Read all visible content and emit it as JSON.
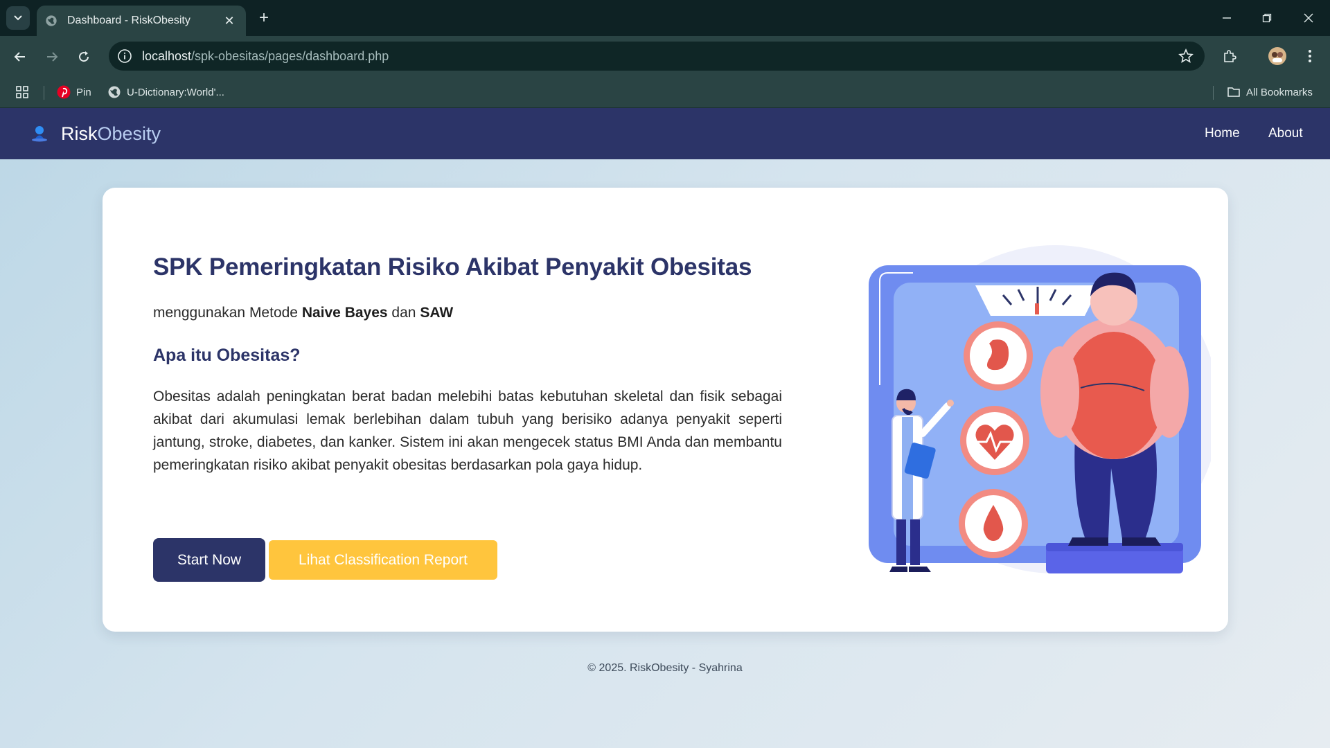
{
  "browser": {
    "tab_title": "Dashboard - RiskObesity",
    "url_host": "localhost",
    "url_path": "/spk-obesitas/pages/dashboard.php",
    "bookmarks": [
      {
        "label": "Pin",
        "icon": "pinterest-icon"
      },
      {
        "label": "U-Dictionary:World'...",
        "icon": "globe-icon"
      }
    ],
    "all_bookmarks_label": "All Bookmarks"
  },
  "site": {
    "brand_part1": "Risk",
    "brand_part2": "Obesity",
    "nav": [
      "Home",
      "About"
    ]
  },
  "hero": {
    "title": "SPK Pemeringkatan Risiko Akibat Penyakit Obesitas",
    "subtitle_prefix": "menggunakan Metode ",
    "subtitle_method1": "Naive Bayes",
    "subtitle_mid": " dan ",
    "subtitle_method2": "SAW",
    "section_heading": "Apa itu Obesitas?",
    "description": "Obesitas adalah peningkatan berat badan melebihi batas kebutuhan skeletal dan fisik sebagai akibat dari akumulasi lemak berlebihan dalam tubuh yang berisiko adanya penyakit seperti jantung, stroke, diabetes, dan kanker. Sistem ini akan mengecek status BMI Anda dan membantu pemeringkatan risiko akibat penyakit obesitas berdasarkan pola gaya hidup.",
    "start_button": "Start Now",
    "report_button": "Lihat Classification Report"
  },
  "footer": {
    "text": "© 2025. RiskObesity - Syahrina"
  },
  "colors": {
    "navbar": "#2c3468",
    "primary_button": "#2c3468",
    "report_button": "#ffc53d",
    "browser_toolbar": "#2a4444"
  }
}
